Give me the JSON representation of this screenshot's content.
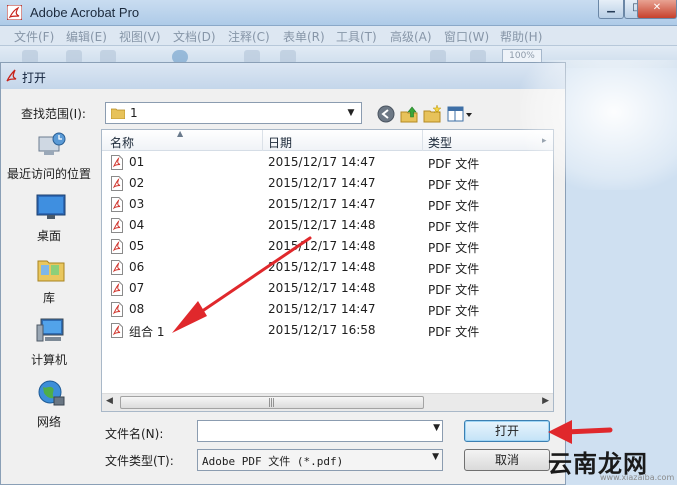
{
  "app": {
    "title": "Adobe Acrobat Pro",
    "window_buttons": {
      "minimize": "▁",
      "maximize": "□",
      "close": "✕"
    },
    "menu": [
      "文件(F)",
      "编辑(E)",
      "视图(V)",
      "文档(D)",
      "注释(C)",
      "表单(R)",
      "工具(T)",
      "高级(A)",
      "窗口(W)",
      "帮助(H)"
    ],
    "toolbar": {
      "zoom": "100%"
    }
  },
  "dialog": {
    "title": "打开",
    "look_in": {
      "label": "查找范围(I):",
      "value": "1"
    },
    "places": [
      {
        "label": "最近访问的位置",
        "icon": "recent-places-icon"
      },
      {
        "label": "桌面",
        "icon": "desktop-icon"
      },
      {
        "label": "库",
        "icon": "libraries-icon"
      },
      {
        "label": "计算机",
        "icon": "computer-icon"
      },
      {
        "label": "网络",
        "icon": "network-icon"
      }
    ],
    "columns": {
      "name": "名称",
      "date": "日期",
      "type": "类型"
    },
    "files": [
      {
        "name": "01",
        "date": "2015/12/17 14:47",
        "type": "PDF 文件"
      },
      {
        "name": "02",
        "date": "2015/12/17 14:47",
        "type": "PDF 文件"
      },
      {
        "name": "03",
        "date": "2015/12/17 14:47",
        "type": "PDF 文件"
      },
      {
        "name": "04",
        "date": "2015/12/17 14:48",
        "type": "PDF 文件"
      },
      {
        "name": "05",
        "date": "2015/12/17 14:48",
        "type": "PDF 文件"
      },
      {
        "name": "06",
        "date": "2015/12/17 14:48",
        "type": "PDF 文件"
      },
      {
        "name": "07",
        "date": "2015/12/17 14:48",
        "type": "PDF 文件"
      },
      {
        "name": "08",
        "date": "2015/12/17 14:47",
        "type": "PDF 文件"
      },
      {
        "name": "组合 1",
        "date": "2015/12/17 16:58",
        "type": "PDF 文件"
      }
    ],
    "filename": {
      "label": "文件名(N):",
      "value": ""
    },
    "filetype": {
      "label": "文件类型(T):",
      "value": "Adobe PDF 文件 (*.pdf)"
    },
    "open_button": "打开",
    "cancel_button": "取消"
  },
  "watermark": {
    "brand": "云南龙网",
    "url": "www.xiazaiba.com"
  },
  "colors": {
    "annotation_arrow": "#e0282c",
    "pdf_icon": "#d0332b",
    "dialog_bg": "#f0f0f0"
  }
}
